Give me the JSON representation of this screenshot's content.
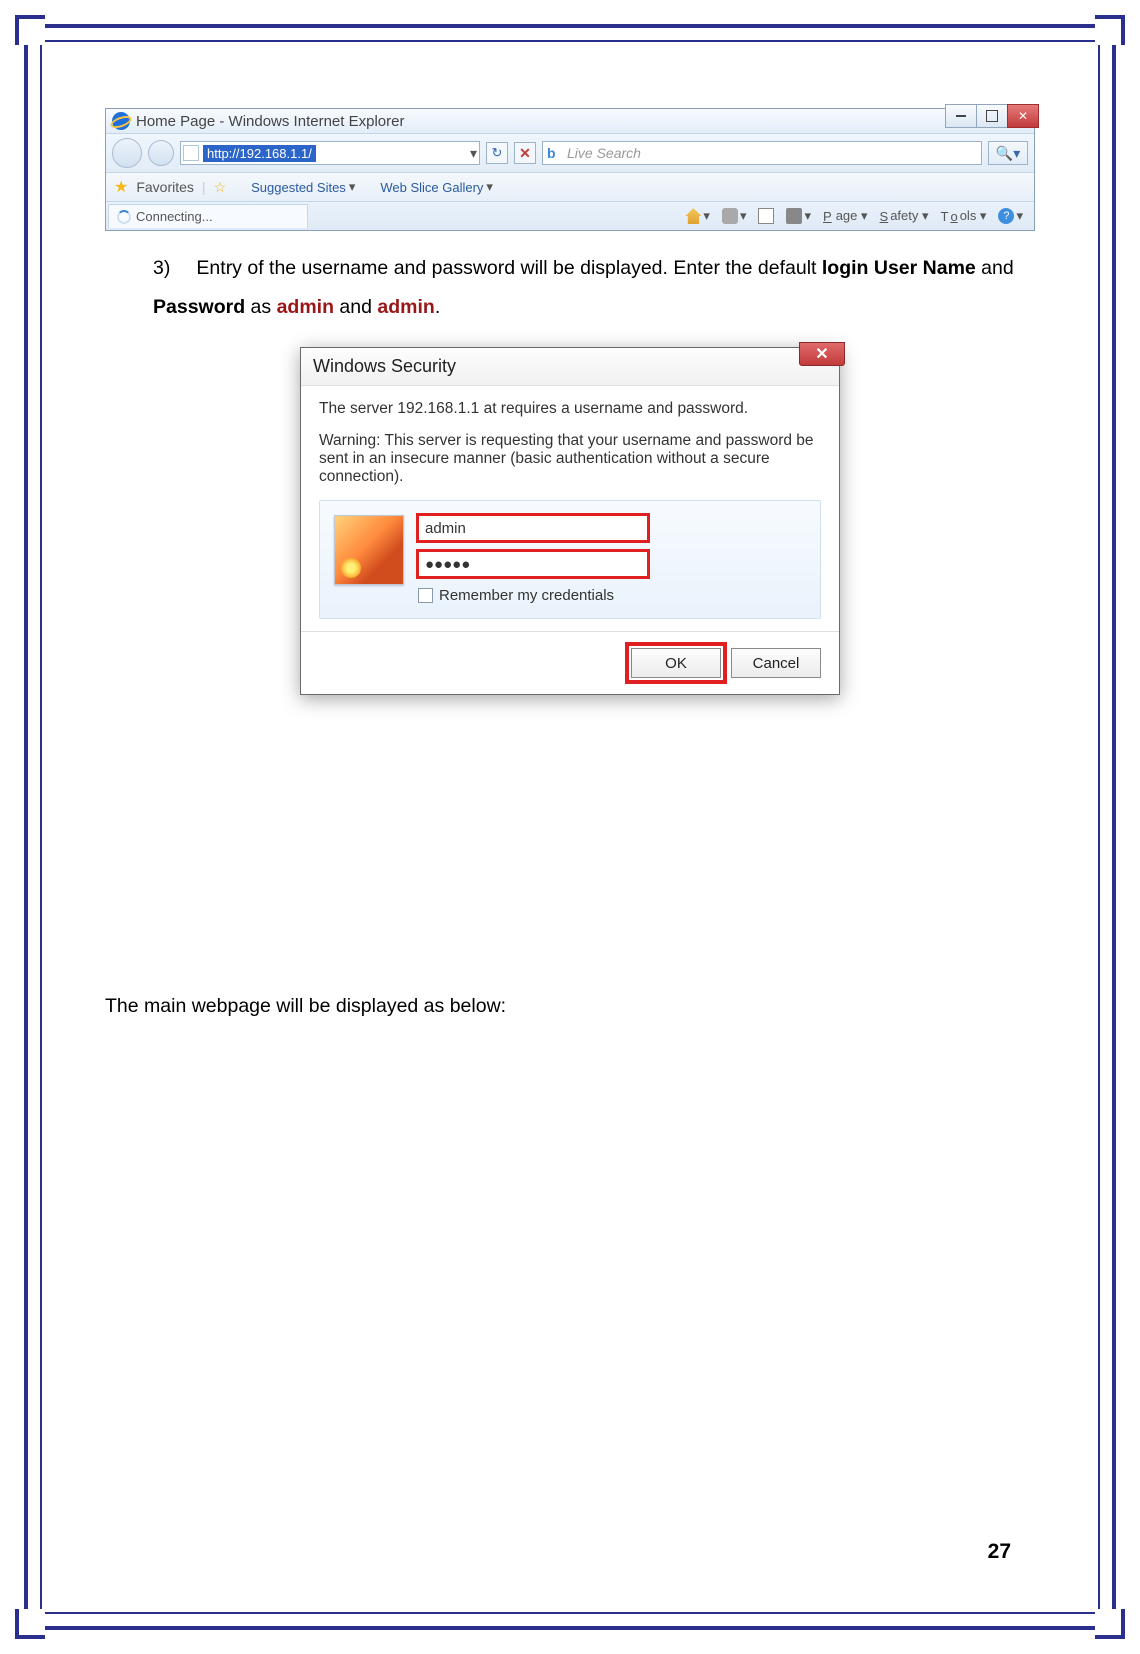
{
  "browser": {
    "title": "Home Page - Windows Internet Explorer",
    "url": "http://192.168.1.1/",
    "favorites_label": "Favorites",
    "suggested_sites": "Suggested Sites",
    "web_slice": "Web Slice Gallery",
    "tab_label": "Connecting...",
    "search_placeholder": "Live Search",
    "menu_page": "Page",
    "menu_safety": "Safety",
    "menu_tools": "Tools"
  },
  "step": {
    "number": "3)",
    "text_before_login": "Entry of the username and password will be displayed. Enter the default ",
    "login_username": "login User Name",
    "and": " and ",
    "password": "Password",
    "as": " as ",
    "admin1": "admin",
    "and2": " and ",
    "admin2": "admin",
    "period": "."
  },
  "dialog": {
    "title": "Windows Security",
    "msg1": "The server 192.168.1.1 at  requires a username and password.",
    "msg2": "Warning: This server is requesting that your username and password be sent in an insecure manner (basic authentication without a secure connection).",
    "username_value": "admin",
    "password_value": "●●●●●",
    "remember_label": "Remember my credentials",
    "ok_label": "OK",
    "cancel_label": "Cancel"
  },
  "footer_text": "The main webpage will be displayed as below:",
  "page_number": "27"
}
